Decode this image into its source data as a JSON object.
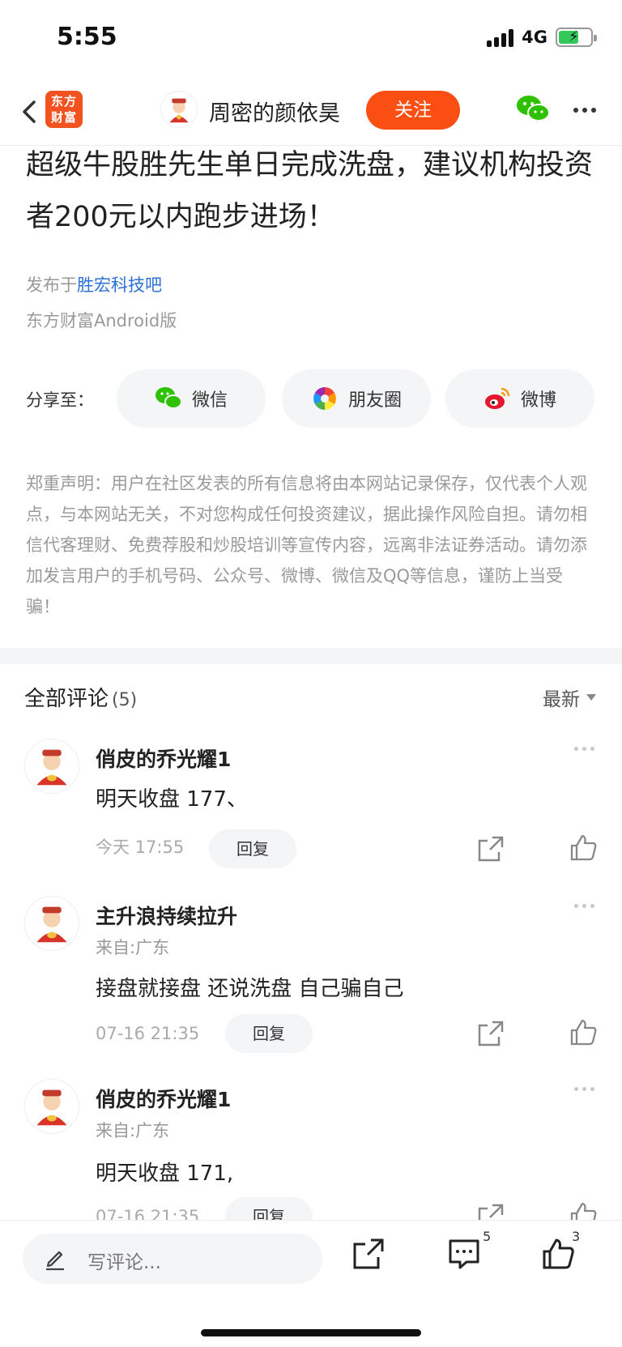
{
  "status_bar": {
    "time": "5:55",
    "network": "4G",
    "battery_charging": true
  },
  "nav": {
    "app_logo_line1": "东方",
    "app_logo_line2": "财富",
    "author_name": "周密的颜依昊",
    "follow_label": "关注",
    "follow_color": "#fa4e12"
  },
  "article": {
    "title": "超级牛股胜先生单日完成洗盘，建议机构投资者200元以内跑步进场！",
    "published_prefix": "发布于",
    "published_bar": "胜宏科技吧",
    "client": "东方财富Android版"
  },
  "share": {
    "label": "分享至：",
    "options": [
      {
        "label": "微信",
        "icon": "wechat-icon"
      },
      {
        "label": "朋友圈",
        "icon": "moments-icon"
      },
      {
        "label": "微博",
        "icon": "weibo-icon"
      }
    ]
  },
  "disclaimer": "郑重声明：用户在社区发表的所有信息将由本网站记录保存，仅代表个人观点，与本网站无关，不对您构成任何投资建议，据此操作风险自担。请勿相信代客理财、免费荐股和炒股培训等宣传内容，远离非法证券活动。请勿添加发言用户的手机号码、公众号、微博、微信及QQ等信息，谨防上当受骗！",
  "comments_section": {
    "title": "全部评论",
    "count": "(5)",
    "sort_label": "最新",
    "items": [
      {
        "name": "俏皮的乔光耀1",
        "origin": "",
        "text": "明天收盘 177、",
        "time": "今天 17:55",
        "reply_label": "回复"
      },
      {
        "name": "主升浪持续拉升",
        "origin": "来自:广东",
        "text": "接盘就接盘 还说洗盘 自己骗自己",
        "time": "07-16 21:35",
        "reply_label": "回复"
      },
      {
        "name": "俏皮的乔光耀1",
        "origin": "来自:广东",
        "text": "明天收盘 171,",
        "time": "07-16 21:35",
        "reply_label": "回复"
      }
    ]
  },
  "bottom_bar": {
    "input_placeholder": "写评论...",
    "comment_count": "5",
    "like_count": "3"
  }
}
